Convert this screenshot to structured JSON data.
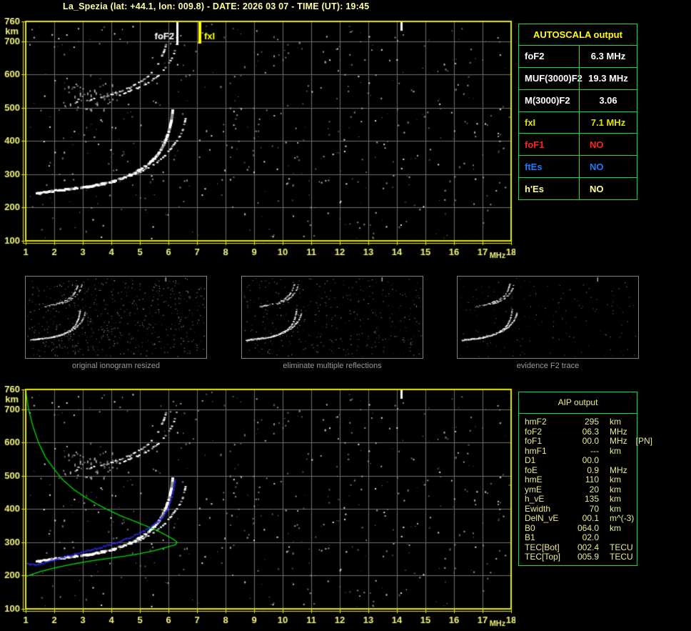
{
  "title": "La_Spezia (lat: +44.1, lon: 009.8) - DATE: 2026 03 07 - TIME (UT): 19:45",
  "colors": {
    "axis_yellow": "#E8E800",
    "tick_label_yellow": "#F2F27A",
    "grid_gray": "#6F6F6F",
    "table_border_green": "#00E050",
    "autoscala_header_yellow": "#FFFF00",
    "value_white": "#FFFFFF",
    "fxI_yellow": "#E2E200",
    "foF1_red": "#FF2020",
    "ftEs_blue": "#2277FF",
    "hEs_pale_yellow": "#FFFF8C",
    "aip_text": "#EDEB8E",
    "profile_green": "#00DC00",
    "restored_trace_blue": "#2B2BE8",
    "caption_gray": "#9A9A9A",
    "title_yellow": "#FFFFA0",
    "foF2_marker_white": "#FFFFFF"
  },
  "autoscala": {
    "title": "AUTOSCALA output",
    "rows": [
      {
        "label": "foF2",
        "value": "6.3 MHz",
        "color": "white"
      },
      {
        "label": "MUF(3000)F2",
        "value": "19.3 MHz",
        "color": "white"
      },
      {
        "label": "M(3000)F2",
        "value": "3.06",
        "color": "white"
      },
      {
        "label": "fxI",
        "value": "7.1 MHz",
        "color": "yellow"
      },
      {
        "label": "foF1",
        "value": "NO",
        "color": "red"
      },
      {
        "label": "ftEs",
        "value": "NO",
        "color": "blue"
      },
      {
        "label": "h'Es",
        "value": "NO",
        "color": "pale"
      }
    ]
  },
  "thumbnails": [
    {
      "caption": "original ionogram resized",
      "noise": 640,
      "dim": 0.75
    },
    {
      "caption": "eliminate multiple reflections",
      "noise": 400,
      "dim": 0.7
    },
    {
      "caption": "evidence F2 trace",
      "noise": 170,
      "dim": 0.55
    }
  ],
  "aip": {
    "title": "AIP output",
    "rows": [
      {
        "label": "hmF2",
        "value": "295",
        "unit": "km",
        "note": ""
      },
      {
        "label": "foF2",
        "value": "06.3",
        "unit": "MHz",
        "note": ""
      },
      {
        "label": "foF1",
        "value": "00.0",
        "unit": "MHz",
        "note": "[PN]"
      },
      {
        "label": "hmF1",
        "value": "---",
        "unit": "km",
        "note": ""
      },
      {
        "label": "D1",
        "value": "00.0",
        "unit": "",
        "note": ""
      },
      {
        "label": "foE",
        "value": "0.9",
        "unit": "MHz",
        "note": ""
      },
      {
        "label": "hmE",
        "value": "110",
        "unit": "km",
        "note": ""
      },
      {
        "label": "ymE",
        "value": "20",
        "unit": "km",
        "note": ""
      },
      {
        "label": "h_vE",
        "value": "135",
        "unit": "km",
        "note": ""
      },
      {
        "label": "Ewidth",
        "value": "70",
        "unit": "km",
        "note": ""
      },
      {
        "label": "DelN_vE",
        "value": "00.1",
        "unit": "m^(-3)",
        "note": ""
      },
      {
        "label": "B0",
        "value": "064.0",
        "unit": "km",
        "note": ""
      },
      {
        "label": "B1",
        "value": "02.0",
        "unit": "",
        "note": ""
      },
      {
        "label": "TEC[Bot]",
        "value": "002.4",
        "unit": "TECU",
        "note": ""
      },
      {
        "label": "TEC[Top]",
        "value": "005.9",
        "unit": "TECU",
        "note": ""
      }
    ]
  },
  "chart_data": {
    "type": "scatter",
    "description": "Ionogram: virtual height (km) vs sounding frequency (MHz), shown twice (autoscaled top, with AIP profile bottom)",
    "xlabel": "MHz",
    "ylabel": "km",
    "x_ticks": [
      1,
      2,
      3,
      4,
      5,
      6,
      7,
      8,
      9,
      10,
      11,
      12,
      13,
      14,
      15,
      16,
      17,
      18
    ],
    "y_ticks": [
      760,
      700,
      600,
      500,
      400,
      300,
      200,
      100
    ],
    "x_range": [
      1,
      18
    ],
    "y_range": [
      100,
      760
    ],
    "markers": {
      "foF2_label": "foF2",
      "foF2_mhz": 6.3,
      "fxI_label": "fxI",
      "fxI_mhz": 7.1
    },
    "interference_mhz": 14.15,
    "traces": {
      "f2_hop1_ordinary": [
        [
          1.4,
          242
        ],
        [
          1.8,
          248
        ],
        [
          2.2,
          252
        ],
        [
          2.8,
          258
        ],
        [
          3.4,
          265
        ],
        [
          4.0,
          276
        ],
        [
          4.5,
          292
        ],
        [
          4.9,
          308
        ],
        [
          5.3,
          330
        ],
        [
          5.6,
          355
        ],
        [
          5.85,
          390
        ],
        [
          6.0,
          425
        ],
        [
          6.1,
          460
        ],
        [
          6.15,
          490
        ]
      ],
      "f2_hop1_extraordinary": [
        [
          1.7,
          247
        ],
        [
          2.3,
          253
        ],
        [
          3.0,
          260
        ],
        [
          3.6,
          270
        ],
        [
          4.2,
          283
        ],
        [
          4.8,
          300
        ],
        [
          5.3,
          320
        ],
        [
          5.7,
          342
        ],
        [
          6.0,
          368
        ],
        [
          6.3,
          400
        ],
        [
          6.5,
          432
        ],
        [
          6.6,
          465
        ]
      ],
      "f2_hop2_ordinary": [
        [
          2.7,
          515
        ],
        [
          3.2,
          522
        ],
        [
          3.7,
          532
        ],
        [
          4.2,
          545
        ],
        [
          4.7,
          562
        ],
        [
          5.1,
          582
        ],
        [
          5.45,
          608
        ],
        [
          5.7,
          640
        ],
        [
          5.85,
          672
        ],
        [
          5.95,
          700
        ]
      ],
      "f2_hop2_extraordinary": [
        [
          4.3,
          538
        ],
        [
          4.8,
          555
        ],
        [
          5.3,
          575
        ],
        [
          5.7,
          600
        ],
        [
          6.0,
          630
        ],
        [
          6.2,
          662
        ],
        [
          6.3,
          695
        ]
      ]
    },
    "profile_green": [
      [
        1.0,
        757
      ],
      [
        1.1,
        700
      ],
      [
        1.25,
        650
      ],
      [
        1.45,
        600
      ],
      [
        1.7,
        555
      ],
      [
        2.0,
        520
      ],
      [
        2.3,
        488
      ],
      [
        2.7,
        458
      ],
      [
        3.1,
        435
      ],
      [
        3.5,
        415
      ],
      [
        3.9,
        397
      ],
      [
        4.35,
        379
      ],
      [
        4.8,
        364
      ],
      [
        5.2,
        350
      ],
      [
        5.6,
        336
      ],
      [
        5.95,
        320
      ],
      [
        6.2,
        308
      ],
      [
        6.3,
        300
      ],
      [
        6.25,
        293
      ],
      [
        6.0,
        287
      ],
      [
        5.5,
        275
      ],
      [
        5.0,
        266
      ],
      [
        4.5,
        259
      ],
      [
        4.0,
        253
      ],
      [
        3.5,
        247
      ],
      [
        3.0,
        240
      ],
      [
        2.5,
        232
      ],
      [
        2.0,
        223
      ],
      [
        1.5,
        212
      ],
      [
        1.0,
        197
      ]
    ],
    "restored_trace_blue": [
      [
        1.05,
        229
      ],
      [
        1.3,
        228
      ],
      [
        1.55,
        230
      ],
      [
        1.8,
        237
      ],
      [
        2.1,
        245
      ],
      [
        2.4,
        252
      ],
      [
        2.7,
        258
      ],
      [
        3.0,
        266
      ],
      [
        3.3,
        272
      ],
      [
        3.6,
        278
      ],
      [
        3.9,
        286
      ],
      [
        4.2,
        294
      ],
      [
        4.5,
        304
      ],
      [
        4.8,
        315
      ],
      [
        5.1,
        327
      ],
      [
        5.4,
        342
      ],
      [
        5.65,
        358
      ],
      [
        5.85,
        378
      ],
      [
        6.0,
        402
      ],
      [
        6.1,
        428
      ],
      [
        6.17,
        455
      ],
      [
        6.22,
        480
      ]
    ]
  }
}
